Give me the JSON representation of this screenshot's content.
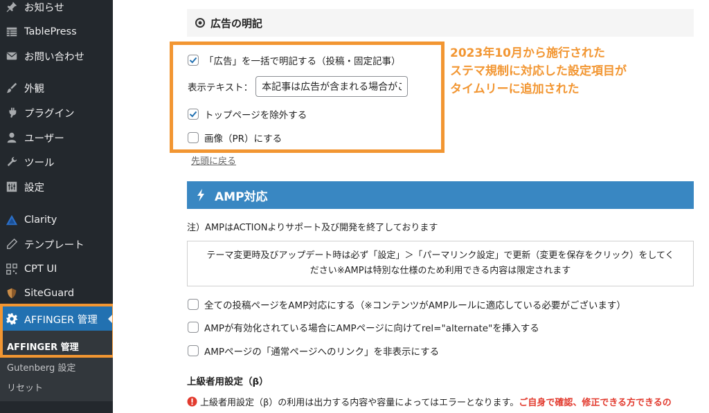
{
  "sidebar": {
    "items": [
      {
        "label": "お知らせ",
        "icon": "pin-icon"
      },
      {
        "label": "TablePress",
        "icon": "table-icon"
      },
      {
        "label": "お問い合わせ",
        "icon": "mail-icon"
      },
      {
        "label": "外観",
        "icon": "brush-icon"
      },
      {
        "label": "プラグイン",
        "icon": "plugin-icon"
      },
      {
        "label": "ユーザー",
        "icon": "user-icon"
      },
      {
        "label": "ツール",
        "icon": "wrench-icon"
      },
      {
        "label": "設定",
        "icon": "settings-icon"
      },
      {
        "label": "Clarity",
        "icon": "clarity-icon"
      },
      {
        "label": "テンプレート",
        "icon": "pencil-icon"
      },
      {
        "label": "CPT UI",
        "icon": "qr-icon"
      },
      {
        "label": "SiteGuard",
        "icon": "shield-icon"
      },
      {
        "label": "AFFINGER 管理",
        "icon": "gear-icon"
      }
    ],
    "submenu": [
      "AFFINGER 管理",
      "Gutenberg 設定",
      "リセット"
    ]
  },
  "ad": {
    "section_title": "広告の明記",
    "checkbox_bulk": "「広告」を一括で明記する（投稿・固定記事）",
    "display_text_label": "表示テキスト：",
    "display_text_value": "本記事は広告が含まれる場合がございます",
    "checkbox_exclude_top": "トップページを除外する",
    "checkbox_image": "画像（PR）にする",
    "back_link": "先頭に戻る"
  },
  "annotation": {
    "line1": "2023年10月から施行された",
    "line2": "ステマ規制に対応した設定項目が",
    "line3": "タイムリーに追加された"
  },
  "amp": {
    "title": "AMP対応",
    "note": "注）AMPはACTIONよりサポート及び開発を終了しております",
    "notice_line1": "テーマ変更時及びアップデート時は必ず「設定」＞「パーマリンク設定」で更新（変更を保存をクリック）をしてく",
    "notice_line2": "ださい※AMPは特別な仕様のため利用できる内容は限定されます",
    "options": [
      "全ての投稿ページをAMP対応にする（※コンテンツがAMPルールに適応している必要がございます）",
      "AMPが有効化されている場合にAMPページに向けてrel=\"alternate\"を挿入する",
      "AMPページの「通常ページへのリンク」を非表示にする"
    ]
  },
  "advanced": {
    "title": "上級者用設定（β）",
    "warning": "上級者用設定（β）の利用は出力する内容や容量によってはエラーとなります。",
    "warning_red": "ご自身で確認、修正できる方できるの"
  },
  "colors": {
    "sidebar_bg": "#23282d",
    "active_bg": "#2271b1",
    "highlight": "#f29632",
    "amp_bar": "#3987c2",
    "check": "#2271b1",
    "warning": "#e23a2e"
  }
}
